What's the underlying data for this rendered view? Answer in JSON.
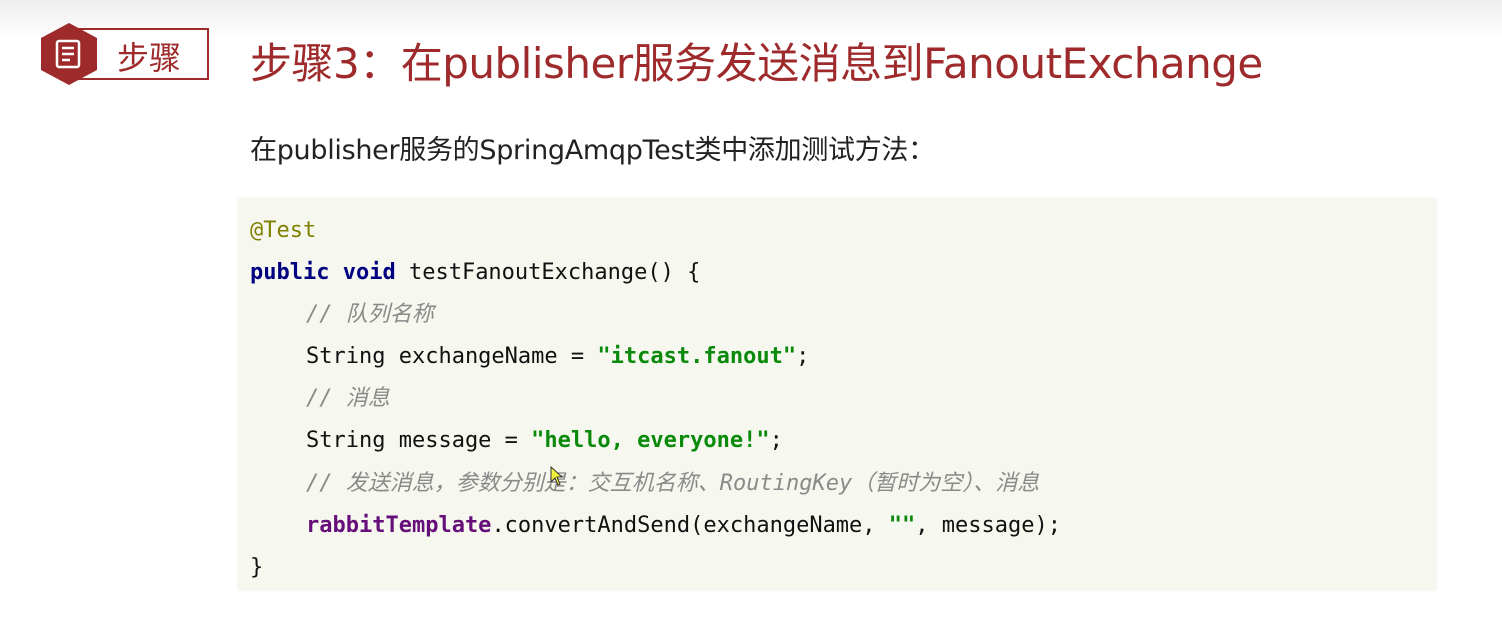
{
  "badge": {
    "label": "步骤",
    "icon": "document-icon",
    "color": "#9e2a2b"
  },
  "title": "步骤3：在publisher服务发送消息到FanoutExchange",
  "subtitle": "在publisher服务的SpringAmqpTest类中添加测试方法：",
  "code": {
    "annotation": "@Test",
    "kw_public": "public",
    "kw_void": "void",
    "method_sig": " testFanoutExchange() {",
    "comment_queue": "// 队列名称",
    "decl_exchange": "String exchangeName = ",
    "str_exchange": "\"itcast.fanout\"",
    "semi1": ";",
    "comment_msg": "// 消息",
    "decl_message": "String message = ",
    "str_message": "\"hello, everyone!\"",
    "semi2": ";",
    "comment_send": "// 发送消息，参数分别是：交互机名称、RoutingKey（暂时为空）、消息",
    "field_template": "rabbitTemplate",
    "call_pre": ".convertAndSend(exchangeName, ",
    "str_empty": "\"\"",
    "call_post": ", message);",
    "close_brace": "}"
  },
  "colors": {
    "accent": "#9e2a2b",
    "code_bg": "#f6f7ee",
    "keyword": "#000080",
    "string": "#0a8a0a",
    "comment": "#8a8a8a",
    "annotation": "#808000",
    "field": "#660e7a"
  }
}
